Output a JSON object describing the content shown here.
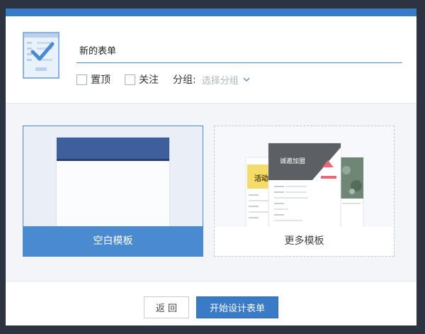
{
  "form": {
    "name_value": "新的表单",
    "options": {
      "pin_label": "置顶",
      "follow_label": "关注",
      "group_label": "分组:",
      "group_placeholder": "选择分组"
    }
  },
  "templates": {
    "blank_label": "空白模板",
    "more_label": "更多模板",
    "more_preview_texts": {
      "activity": "活动",
      "recruit": "诚邀加盟"
    }
  },
  "footer": {
    "back_label": "返 回",
    "start_label": "开始设计表单"
  },
  "colors": {
    "accent": "#4a8ad0",
    "top_bar": "#3a7bc8",
    "preview_header": "#3e5f9c"
  }
}
